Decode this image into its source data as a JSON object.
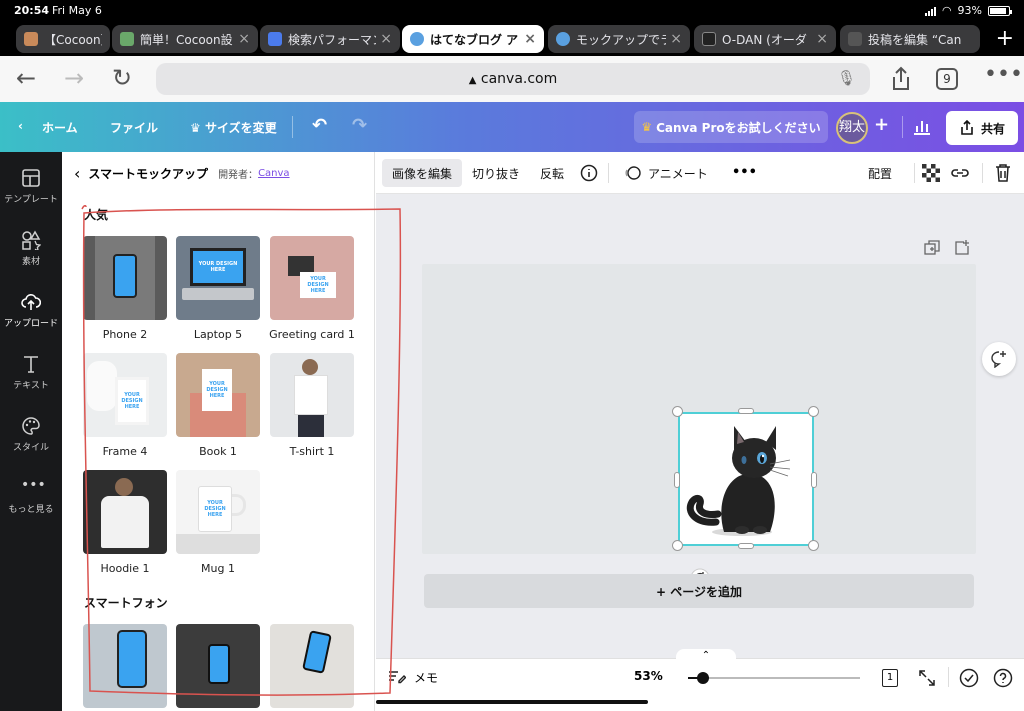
{
  "status_bar": {
    "time": "20:54",
    "date": "Fri May 6",
    "battery": "93%"
  },
  "browser_tabs": [
    {
      "title": "【Cocoon】",
      "favicon_color": "#c98a5a"
    },
    {
      "title": "簡単！Cocoon設",
      "favicon_color": "#6aa86a"
    },
    {
      "title": "検索パフォーマン",
      "favicon_color": "#4b7bec"
    },
    {
      "title": "はてなブログ ア",
      "favicon_color": "#5aa0e0",
      "active": true
    },
    {
      "title": "モックアップでラ",
      "favicon_color": "#5aa0e0"
    },
    {
      "title": "O-DAN (オーダ",
      "favicon_color": "#222222"
    },
    {
      "title": "投稿を編集 “Can",
      "favicon_color": "#555555"
    }
  ],
  "browser": {
    "url": "canva.com",
    "tab_count": "9"
  },
  "canva_header": {
    "home": "ホーム",
    "file": "ファイル",
    "resize": "サイズを変更",
    "pro_cta": "Canva Proをお試しください",
    "avatar": "翔太",
    "share": "共有"
  },
  "rail": [
    {
      "label": "テンプレート",
      "icon": "template-icon"
    },
    {
      "label": "素材",
      "icon": "elements-icon"
    },
    {
      "label": "アップロード",
      "icon": "upload-icon",
      "active": true
    },
    {
      "label": "テキスト",
      "icon": "text-icon"
    },
    {
      "label": "スタイル",
      "icon": "palette-icon"
    },
    {
      "label": "もっと見る",
      "icon": "more-icon"
    }
  ],
  "panel": {
    "title": "スマートモックアップ",
    "developer_label": "開発者：",
    "developer_link": "Canva",
    "section_popular": "人気",
    "section_smartphone": "スマートフォン",
    "mockups": [
      {
        "label": "Phone 2"
      },
      {
        "label": "Laptop 5"
      },
      {
        "label": "Greeting card 1"
      },
      {
        "label": "Frame 4"
      },
      {
        "label": "Book 1"
      },
      {
        "label": "T-shirt 1"
      },
      {
        "label": "Hoodie 1"
      },
      {
        "label": "Mug 1"
      }
    ],
    "placeholder_text": "YOUR DESIGN HERE"
  },
  "toolbar": {
    "edit_image": "画像を編集",
    "crop": "切り抜き",
    "flip": "反転",
    "animate": "アニメート",
    "position": "配置"
  },
  "workspace": {
    "add_page": "+ ページを追加"
  },
  "bottom_bar": {
    "notes": "メモ",
    "zoom": "53%",
    "zoom_fraction": 0.09,
    "page_number": "1"
  },
  "colors": {
    "header_gradient_start": "#3bbfc7",
    "header_gradient_end": "#7b4ee4",
    "selection": "#4fcfd6",
    "annotation": "#d9534f"
  }
}
